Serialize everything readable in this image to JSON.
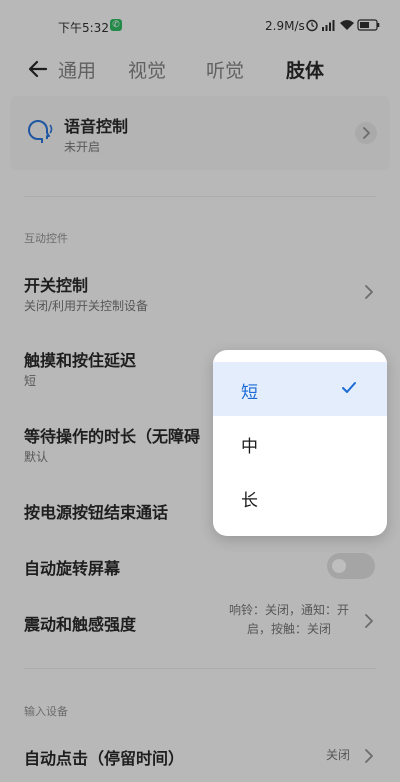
{
  "status_bar": {
    "time": "下午5:32",
    "call_badge": "✆",
    "net_speed": "2.9M/s",
    "battery": "45"
  },
  "tabs": [
    {
      "label": "通用",
      "active": false
    },
    {
      "label": "视觉",
      "active": false
    },
    {
      "label": "听觉",
      "active": false
    },
    {
      "label": "肢体",
      "active": true
    }
  ],
  "voice_card": {
    "title": "语音控制",
    "subtitle": "未开启"
  },
  "sections": {
    "interaction": "互动控件",
    "input": "输入设备"
  },
  "rows": {
    "switch_control": {
      "title": "开关控制",
      "subtitle": "关闭/利用开关控制设备"
    },
    "touch_hold": {
      "title": "触摸和按住延迟",
      "subtitle": "短"
    },
    "wait_time": {
      "title": "等待操作的时长（无障碍",
      "subtitle": "默认"
    },
    "power_end_call": {
      "title": "按电源按钮结束通话"
    },
    "auto_rotate": {
      "title": "自动旋转屏幕",
      "toggle_on": false
    },
    "vibration": {
      "title": "震动和触感强度",
      "value_line1": "响铃：关闭，通知：开",
      "value_line2": "启，按触：关闭"
    },
    "auto_click": {
      "title": "自动点击（停留时间）",
      "value": "关闭"
    }
  },
  "popup": {
    "options": [
      {
        "label": "短",
        "selected": true
      },
      {
        "label": "中",
        "selected": false
      },
      {
        "label": "长",
        "selected": false
      }
    ]
  },
  "colors": {
    "accent": "#1a6bd6",
    "selected_bg": "#e3edfb",
    "call_green": "#22b55a"
  }
}
